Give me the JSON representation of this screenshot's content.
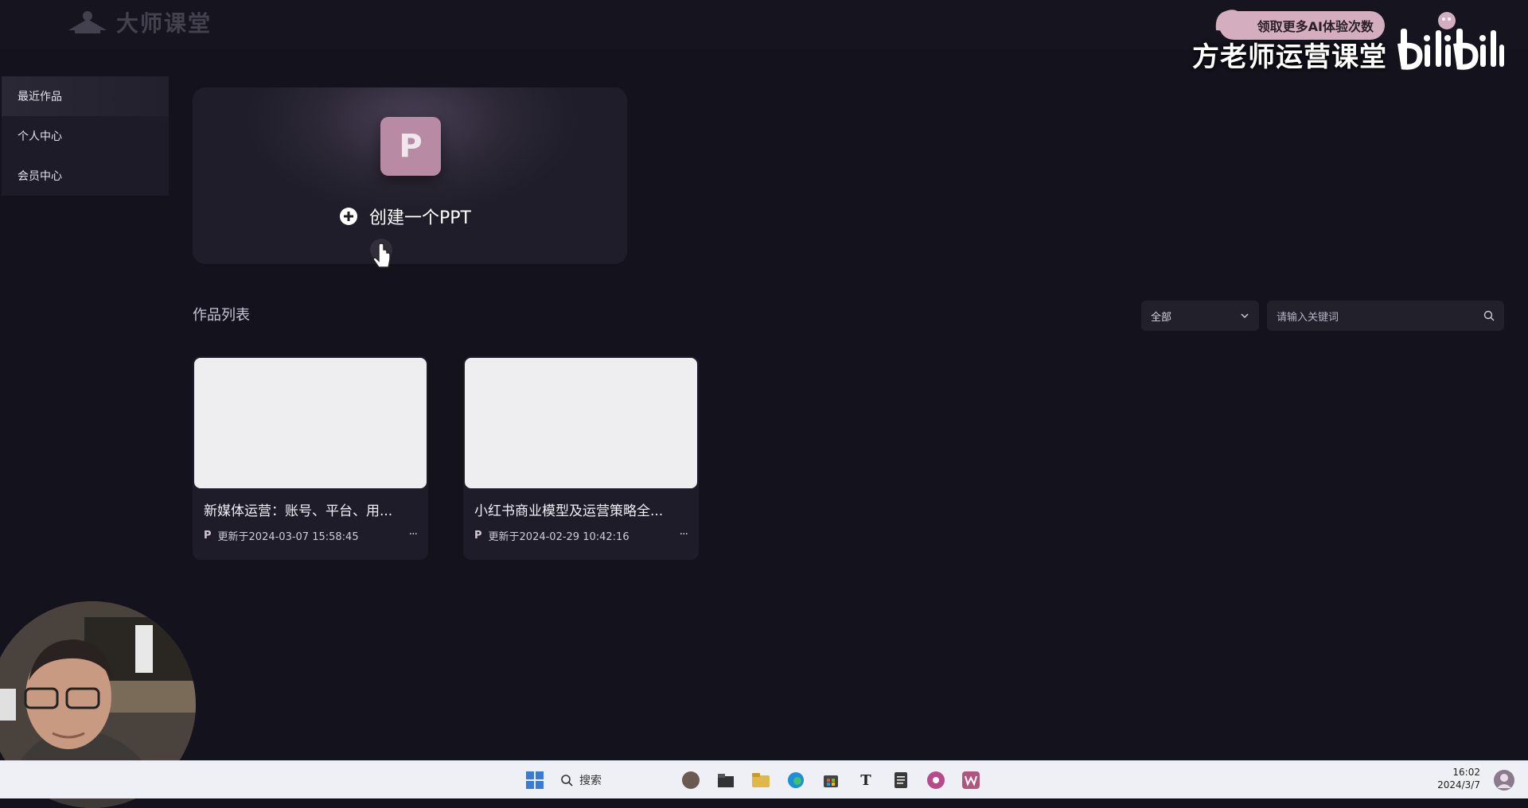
{
  "header": {
    "brand_name": "大师课堂"
  },
  "watermark": {
    "promo_text": "领取更多AI体验次数",
    "channel_name": "方老师运营课堂",
    "platform_logo": "bilibili"
  },
  "sidebar": {
    "items": [
      {
        "label": "最近作品",
        "active": true
      },
      {
        "label": "个人中心",
        "active": false
      },
      {
        "label": "会员中心",
        "active": false
      }
    ]
  },
  "create": {
    "tile_letter": "P",
    "label": "创建一个PPT"
  },
  "works": {
    "title": "作品列表",
    "filter_selected": "全部",
    "search_placeholder": "请输入关键词",
    "items": [
      {
        "title": "新媒体运营：账号、平台、用...",
        "badge": "P",
        "updated": "更新于2024-03-07 15:58:45",
        "more": "···"
      },
      {
        "title": "小红书商业模型及运营策略全...",
        "badge": "P",
        "updated": "更新于2024-02-29 10:42:16",
        "more": "···"
      }
    ]
  },
  "taskbar": {
    "search_label": "搜索",
    "time": "16:02",
    "date": "2024/3/7",
    "icons": [
      "windows-start-icon",
      "search-icon",
      "app-icon",
      "file-explorer-icon",
      "folder-icon",
      "edge-browser-icon",
      "store-icon",
      "text-icon",
      "notepad-icon",
      "music-app-icon",
      "wps-icon"
    ]
  },
  "colors": {
    "background": "#14121d",
    "card": "#1e1c28",
    "ppt_tile": "#b98aa3",
    "promo_pill": "#d4aebe"
  }
}
